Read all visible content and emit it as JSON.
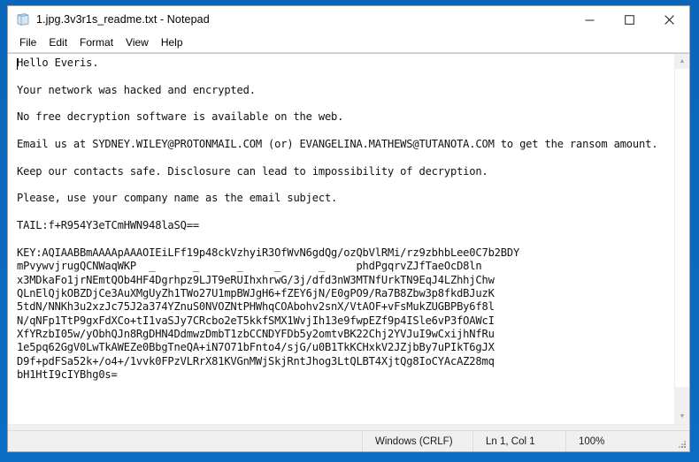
{
  "window": {
    "title": "1.jpg.3v3r1s_readme.txt - Notepad",
    "icon": "notepad-document-icon",
    "controls": {
      "minimize_label": "—",
      "maximize_label": "☐",
      "close_label": "✕"
    }
  },
  "menu": {
    "items": [
      {
        "label": "File"
      },
      {
        "label": "Edit"
      },
      {
        "label": "Format"
      },
      {
        "label": "View"
      },
      {
        "label": "Help"
      }
    ]
  },
  "document": {
    "lines": [
      "Hello Everis.",
      "",
      "Your network was hacked and encrypted.",
      "",
      "No free decryption software is available on the web.",
      "",
      "Email us at SYDNEY.WILEY@PROTONMAIL.COM (or) EVANGELINA.MATHEWS@TUTANOTA.COM to get the ransom amount.",
      "",
      "Keep our contacts safe. Disclosure can lead to impossibility of decryption.",
      "",
      "Please, use your company name as the email subject.",
      "",
      "TAIL:f+R954Y3eTCmHWN948laSQ==",
      "",
      "KEY:AQIAABBmAAAApAAAOIEiLFf19p48ckVzhyiR3OfWvN6gdQg/ozQbVlRMi/rz9zbhbLee0C7b2BDY",
      "mPvywvjrugQCNWaqWKP  _      _      _     _      _     phdPgqrvZJfTaeOcD8ln",
      "x3MDkaFo1jrNEmtQOb4HF4Dgrhpz9LJT9eRUIhxhrwG/3j/dfd3nW3MTNfUrkTN9EqJ4LZhhjChw",
      "QLnElQjkOBZDjCe3AuXMgUyZh1TWo27U1mpBWJgH6+fZEY6jN/E0gPO9/Ra7B8Zbw3p8fkdBJuzK",
      "5tdN/NNKh3u2xzJc75J2a374YZnuS0NVOZNtPHWhqCOAbohv2snX/VtAOF+vFsMukZUGBPBy6f8l",
      "N/qNFp1TtP9gxFdXCo+tI1vaSJy7CRcbo2eT5kkfSMX1WvjIh13e9fwpEZf9p4ISle6vP3fOAWcI",
      "XfYRzbI05w/yObhQJn8RgDHN4DdmwzDmbT1zbCCNDYFDb5y2omtvBK22Chj2YVJuI9wCxijhNfRu",
      "1e5pq62GgV0LwTkAWEZe0BbgTneQA+iN7O71bFnto4/sjG/u0B1TkKCHxkV2JZjbBy7uPIkT6gJX",
      "D9f+pdFSa52k+/o4+/1vvk0FPzVLRrX81KVGnMWjSkjRntJhog3LtQLBT4XjtQg8IoCYAcAZ28mq",
      "bH1HtI9cIYBhg0s="
    ]
  },
  "status_bar": {
    "encoding": "Windows (CRLF)",
    "position": "Ln 1, Col 1",
    "zoom": "100%"
  },
  "scrollbar": {
    "up_arrow": "▲",
    "down_arrow": "▼"
  },
  "colors": {
    "desktop": "#0a6abf",
    "window_bg": "#ffffff",
    "status_bg": "#f0f0f0",
    "text": "#111111",
    "close_hover": "#e81123"
  }
}
